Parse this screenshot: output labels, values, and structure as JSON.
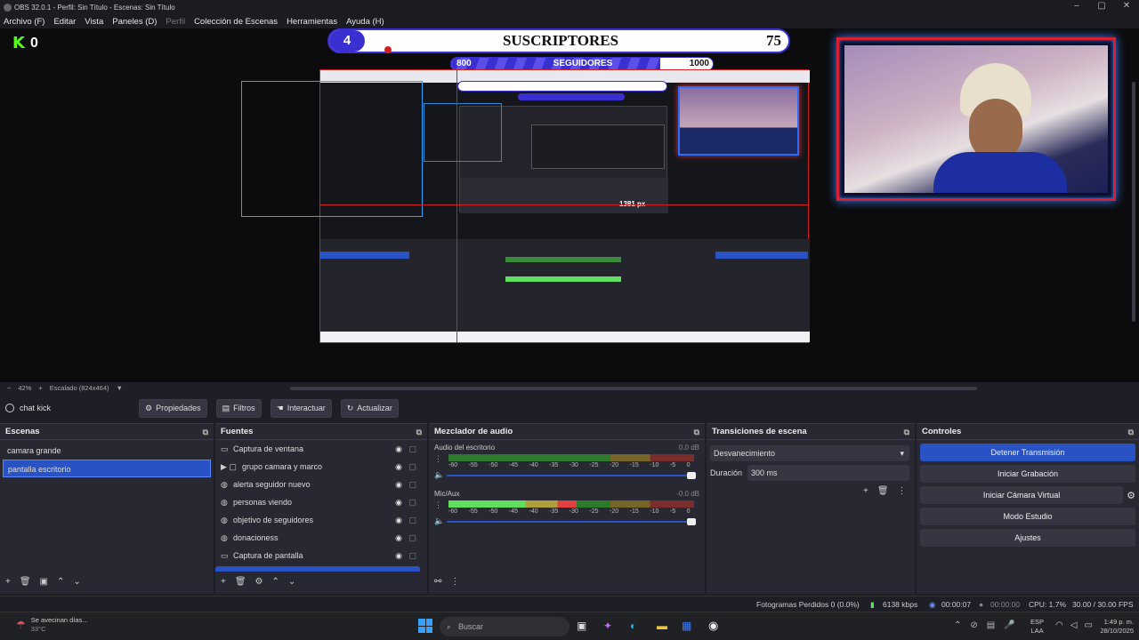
{
  "window": {
    "title": "OBS 32.0.1 - Perfil: Sin Título - Escenas: Sin Título"
  },
  "menu": {
    "items": [
      "Archivo (F)",
      "Editar",
      "Vista",
      "Paneles (D)",
      "Perfil",
      "Colección de Escenas",
      "Herramientas",
      "Ayuda (H)"
    ]
  },
  "overlay": {
    "kick_count": "0",
    "subs_badge": "4",
    "subs_label": "SUSCRIPTORES",
    "subs_goal": "75",
    "followers_current": "800",
    "followers_label": "SEGUIDORES",
    "followers_goal": "1000",
    "measure_label": "1381 px"
  },
  "zoom": {
    "value": "42%",
    "scale_label": "Escalado (824x464)"
  },
  "source_toolbar": {
    "selected": "chat kick",
    "properties": "Propiedades",
    "filters": "Filtros",
    "interact": "Interactuar",
    "refresh": "Actualizar"
  },
  "scenes": {
    "title": "Escenas",
    "items": [
      "camara grande",
      "pantalla escritorio"
    ],
    "selected_index": 1
  },
  "sources": {
    "title": "Fuentes",
    "items": [
      {
        "name": "Captura de ventana",
        "icon": "window-icon"
      },
      {
        "name": "grupo camara y marco",
        "icon": "folder-icon"
      },
      {
        "name": "alerta seguidor nuevo",
        "icon": "globe-icon"
      },
      {
        "name": "personas viendo",
        "icon": "globe-icon"
      },
      {
        "name": "objetivo de seguidores",
        "icon": "globe-icon"
      },
      {
        "name": "donacioness",
        "icon": "globe-icon"
      },
      {
        "name": "Captura de pantalla",
        "icon": "monitor-icon"
      }
    ]
  },
  "mixer": {
    "title": "Mezclador de audio",
    "channels": [
      {
        "name": "Audio del escritorio",
        "db": "0.0 dB",
        "level": 0
      },
      {
        "name": "Mic/Aux",
        "db": "-0.0 dB",
        "level": 0.52
      }
    ],
    "ticks": [
      "-60",
      "-55",
      "-50",
      "-45",
      "-40",
      "-35",
      "-30",
      "-25",
      "-20",
      "-15",
      "-10",
      "-5",
      "0"
    ]
  },
  "transitions": {
    "title": "Transiciones de escena",
    "selected": "Desvanecimiento",
    "duration_label": "Duración",
    "duration_value": "300 ms"
  },
  "controls": {
    "title": "Controles",
    "buttons": [
      "Detener Transmisión",
      "Iniciar Grabación",
      "Iniciar Cámara Virtual",
      "Modo Estudio",
      "Ajustes"
    ]
  },
  "status": {
    "dropped": "Fotogramas Perdidos 0 (0.0%)",
    "bitrate": "6138 kbps",
    "stream_time": "00:00:07",
    "rec_time": "00:00:00",
    "cpu": "CPU: 1.7%",
    "fps": "30.00 / 30.00 FPS"
  },
  "taskbar": {
    "weather_text": "Se avecinan días...",
    "weather_temp": "33°C",
    "search": "Buscar",
    "lang": "ESP",
    "lang2": "LAA",
    "time": "1:49 p. m.",
    "date": "28/10/2025"
  },
  "colors": {
    "accent": "#2953c4",
    "panel": "#272832",
    "bg": "#1e1f26",
    "kick": "#53fc18",
    "overlay_purple": "#3a2fd0",
    "meter_green": "#5fe05f",
    "meter_red": "#e04040"
  }
}
